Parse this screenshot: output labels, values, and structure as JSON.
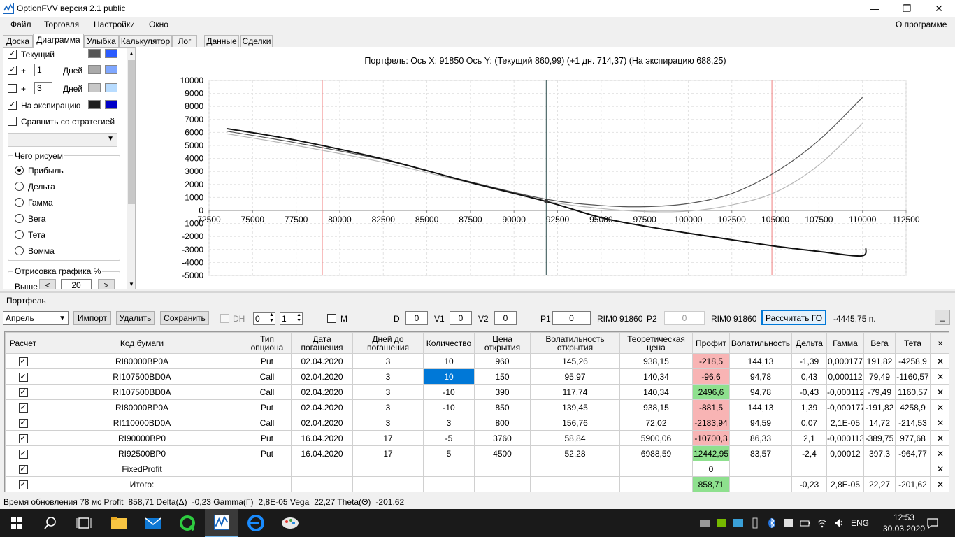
{
  "window": {
    "title": "OptionFVV версия 2.1 public"
  },
  "menu": {
    "items": [
      "Файл",
      "Торговля",
      "Настройки",
      "Окно"
    ],
    "about": "О программе"
  },
  "tabs": [
    "Доска",
    "Диаграмма",
    "Улыбка",
    "Калькулятор",
    "Лог",
    "Данные",
    "Сделки"
  ],
  "active_tab": "Диаграмма",
  "left_panel": {
    "current": {
      "label": "Текущий",
      "checked": true,
      "colors": [
        "#555555",
        "#2b5cff"
      ]
    },
    "plus1": {
      "plus": "+",
      "value": "1",
      "unit": "Дней",
      "checked": true,
      "colors": [
        "#aaaaaa",
        "#7fa7ff"
      ]
    },
    "plus3": {
      "plus": "+",
      "value": "3",
      "unit": "Дней",
      "checked": false,
      "colors": [
        "#c8c8c8",
        "#b8dcff"
      ]
    },
    "expiry": {
      "label": "На экспирацию",
      "checked": true,
      "colors": [
        "#1e1e1e",
        "#0000c8"
      ]
    },
    "compare": {
      "label": "Сравнить со стратегией",
      "checked": false
    },
    "draw_group": {
      "title": "Чего рисуем",
      "options": [
        "Прибыль",
        "Дельта",
        "Гамма",
        "Вега",
        "Тета",
        "Вомма"
      ],
      "selected": "Прибыль"
    },
    "render_group": {
      "title": "Отрисовка графика %",
      "above_label": "Выше",
      "above_value": "20",
      "prev": "<",
      "next": ">"
    }
  },
  "chart_data": {
    "type": "line",
    "title": "Портфель: Ось X: 91850 Ось Y: (Текущий 860,99) (+1 дн. 714,37) (На экспирацию 688,25)",
    "xlim": [
      72500,
      112500
    ],
    "ylim": [
      -5000,
      10000
    ],
    "x_ticks": [
      72500,
      75000,
      77500,
      80000,
      82500,
      85000,
      87500,
      90000,
      92500,
      95000,
      97500,
      100000,
      102500,
      105000,
      107500,
      110000,
      112500
    ],
    "y_ticks": [
      10000,
      9000,
      8000,
      7000,
      6000,
      5000,
      4000,
      3000,
      2000,
      1000,
      0,
      -1000,
      -2000,
      -3000,
      -4000,
      -5000
    ],
    "grid": true,
    "vlines": [
      {
        "x": 79000,
        "color": "#f08080"
      },
      {
        "x": 91850,
        "color": "#2f4f4f"
      },
      {
        "x": 104800,
        "color": "#f08080"
      }
    ],
    "marker": {
      "x": 91850,
      "y": 700
    },
    "series": [
      {
        "color": "#555555",
        "x": [
          73500,
          77500,
          82500,
          87500,
          91850,
          95000,
          97500,
          100000,
          102500,
          105000,
          107500,
          110000
        ],
        "y": [
          6100,
          5200,
          3900,
          2200,
          861,
          380,
          290,
          530,
          1300,
          2950,
          5400,
          8700
        ]
      },
      {
        "color": "#b8b8b8",
        "x": [
          73500,
          77500,
          82500,
          87500,
          91850,
          95000,
          97500,
          100000,
          102500,
          105000,
          107500,
          110000
        ],
        "y": [
          5900,
          5000,
          3700,
          2100,
          714,
          150,
          -80,
          -50,
          420,
          1400,
          3500,
          6700
        ]
      },
      {
        "color": "#111111",
        "x": [
          73500,
          77500,
          82500,
          87500,
          91850,
          95000,
          97500,
          100000,
          102500,
          105000,
          107500,
          109900,
          110200
        ],
        "y": [
          6300,
          5400,
          3950,
          2150,
          688,
          -550,
          -1200,
          -1750,
          -2250,
          -2750,
          -3150,
          -3500,
          -2900
        ]
      }
    ]
  },
  "portfolio": {
    "label": "Портфель",
    "expiry_select": "Апрель",
    "import_btn": "Импорт",
    "delete_btn": "Удалить",
    "save_btn": "Сохранить",
    "dh_label": "DH",
    "spin1": "0",
    "spin2": "1",
    "m_label": "M",
    "d_label": "D",
    "d_value": "0",
    "v1_label": "V1",
    "v1_value": "0",
    "v2_label": "V2",
    "v2_value": "0",
    "p1_label": "P1",
    "p1_value": "0",
    "rim1": "RIM0 91860",
    "p2_label": "P2",
    "p2_value": "0",
    "rim2": "RIM0 91860",
    "calc_btn": "Рассчитать ГО",
    "go_value": "-4445,75 п.",
    "minimize": "_"
  },
  "table": {
    "columns": [
      "Расчет",
      "Код бумаги",
      "Тип опциона",
      "Дата погашения",
      "Дней до погашения",
      "Количество",
      "Цена открытия",
      "Волатильность открытия",
      "Теоретическая цена",
      "Профит",
      "Волатильность",
      "Дельта",
      "Гамма",
      "Вега",
      "Тета",
      "×"
    ],
    "rows": [
      [
        "✓",
        "RI80000BP0A",
        "Put",
        "02.04.2020",
        "3",
        "10",
        "960",
        "145,26",
        "938,15",
        "-218,5",
        "144,13",
        "-1,39",
        "0,000177",
        "191,82",
        "-4258,9",
        "✕"
      ],
      [
        "✓",
        "RI107500BD0A",
        "Call",
        "02.04.2020",
        "3",
        "10",
        "150",
        "95,97",
        "140,34",
        "-96,6",
        "94,78",
        "0,43",
        "0,000112",
        "79,49",
        "-1160,57",
        "✕"
      ],
      [
        "✓",
        "RI107500BD0A",
        "Call",
        "02.04.2020",
        "3",
        "-10",
        "390",
        "117,74",
        "140,34",
        "2496,6",
        "94,78",
        "-0,43",
        "-0,000112",
        "-79,49",
        "1160,57",
        "✕"
      ],
      [
        "✓",
        "RI80000BP0A",
        "Put",
        "02.04.2020",
        "3",
        "-10",
        "850",
        "139,45",
        "938,15",
        "-881,5",
        "144,13",
        "1,39",
        "-0,000177",
        "-191,82",
        "4258,9",
        "✕"
      ],
      [
        "✓",
        "RI110000BD0A",
        "Call",
        "02.04.2020",
        "3",
        "3",
        "800",
        "156,76",
        "72,02",
        "-2183,94",
        "94,59",
        "0,07",
        "2,1E-05",
        "14,72",
        "-214,53",
        "✕"
      ],
      [
        "✓",
        "RI90000BP0",
        "Put",
        "16.04.2020",
        "17",
        "-5",
        "3760",
        "58,84",
        "5900,06",
        "-10700,3",
        "86,33",
        "2,1",
        "-0,000113",
        "-389,75",
        "977,68",
        "✕"
      ],
      [
        "✓",
        "RI92500BP0",
        "Put",
        "16.04.2020",
        "17",
        "5",
        "4500",
        "52,28",
        "6988,59",
        "12442,95",
        "83,57",
        "-2,4",
        "0,00012",
        "397,3",
        "-964,77",
        "✕"
      ],
      [
        "✓",
        "FixedProfit",
        "",
        "",
        "",
        "",
        "",
        "",
        "",
        "0",
        "",
        "",
        "",
        "",
        "",
        "✕"
      ],
      [
        "✓",
        "Итого:",
        "",
        "",
        "",
        "",
        "",
        "",
        "",
        "858,71",
        "",
        "-0,23",
        "2,8E-05",
        "22,27",
        "-201,62",
        "✕"
      ]
    ],
    "profit_class": [
      "neg",
      "neg",
      "pos",
      "neg",
      "neg",
      "neg",
      "pos",
      "",
      "pos"
    ]
  },
  "status": {
    "text": "Время обновления 78 мс  Profit=858,71 Delta(Δ)=-0,23 Gamma(Γ)=2,8E-05 Vega=22,27 Theta(Θ)=-201,62"
  },
  "taskbar": {
    "lang": "ENG",
    "time": "12:53",
    "date": "30.03.2020"
  }
}
